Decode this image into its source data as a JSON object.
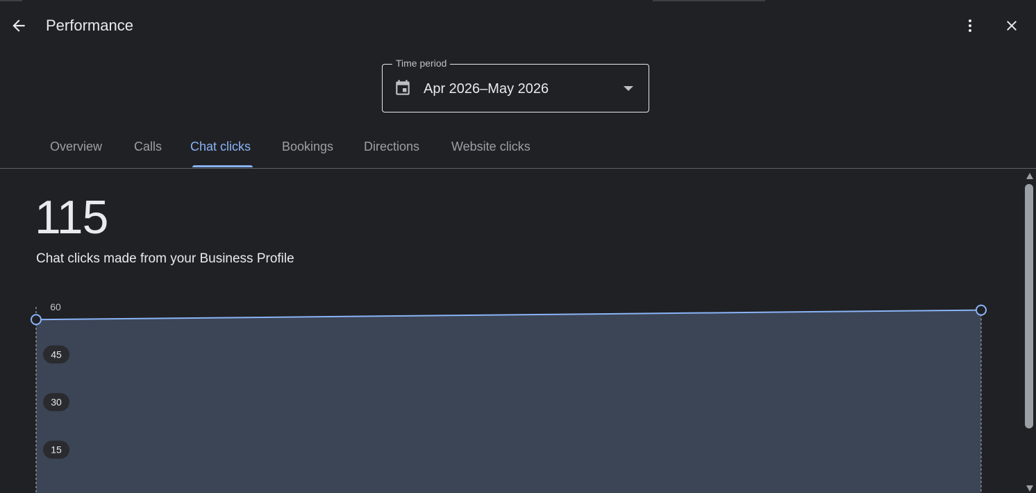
{
  "header": {
    "title": "Performance",
    "back_icon": "arrow-back-icon",
    "more_icon": "more-vert-icon",
    "close_icon": "close-icon"
  },
  "time_period": {
    "label": "Time period",
    "value": "Apr 2026–May 2026",
    "icon": "calendar-icon"
  },
  "tabs": [
    {
      "label": "Overview",
      "active": false
    },
    {
      "label": "Calls",
      "active": false
    },
    {
      "label": "Chat clicks",
      "active": true
    },
    {
      "label": "Bookings",
      "active": false
    },
    {
      "label": "Directions",
      "active": false
    },
    {
      "label": "Website clicks",
      "active": false
    }
  ],
  "summary": {
    "total": "115",
    "description": "Chat clicks made from your Business Profile"
  },
  "colors": {
    "accent": "#8ab4f8",
    "area_fill": "#3c4556",
    "background": "#202124",
    "text": "#e8eaed"
  },
  "chart_data": {
    "type": "area",
    "y_ticks": [
      "60",
      "45",
      "30",
      "15"
    ],
    "ylim": [
      0,
      60
    ],
    "series": [
      {
        "values": [
          56,
          59
        ]
      }
    ]
  }
}
